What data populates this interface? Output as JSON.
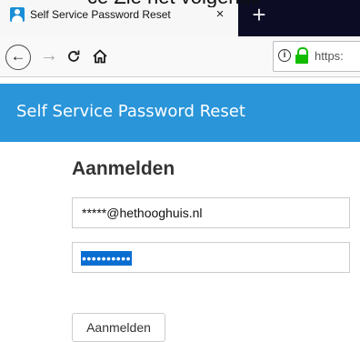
{
  "overlay_caption": "ce Zie het volgende",
  "browser": {
    "tab": {
      "title": "Self Service Password Reset",
      "close_glyph": "×",
      "favicon": "person-icon"
    },
    "new_tab_glyph": "+",
    "nav": {
      "back_glyph": "←",
      "forward_glyph": "→",
      "reload_glyph": "C",
      "home_glyph": "⌂"
    },
    "url": {
      "info_glyph": "i",
      "text": "https:"
    }
  },
  "site": {
    "title": "Self Service Password Reset"
  },
  "form": {
    "heading": "Aanmelden",
    "login_value": "*****@hethooghuis.nl",
    "password_value": "••••••••••",
    "submit_label": "Aanmelden"
  },
  "colors": {
    "header_bg": "#2a95d9",
    "selection_bg": "#0a6ed1",
    "lock_green": "#12bc00",
    "tabstrip_bg": "#0c0c24"
  }
}
